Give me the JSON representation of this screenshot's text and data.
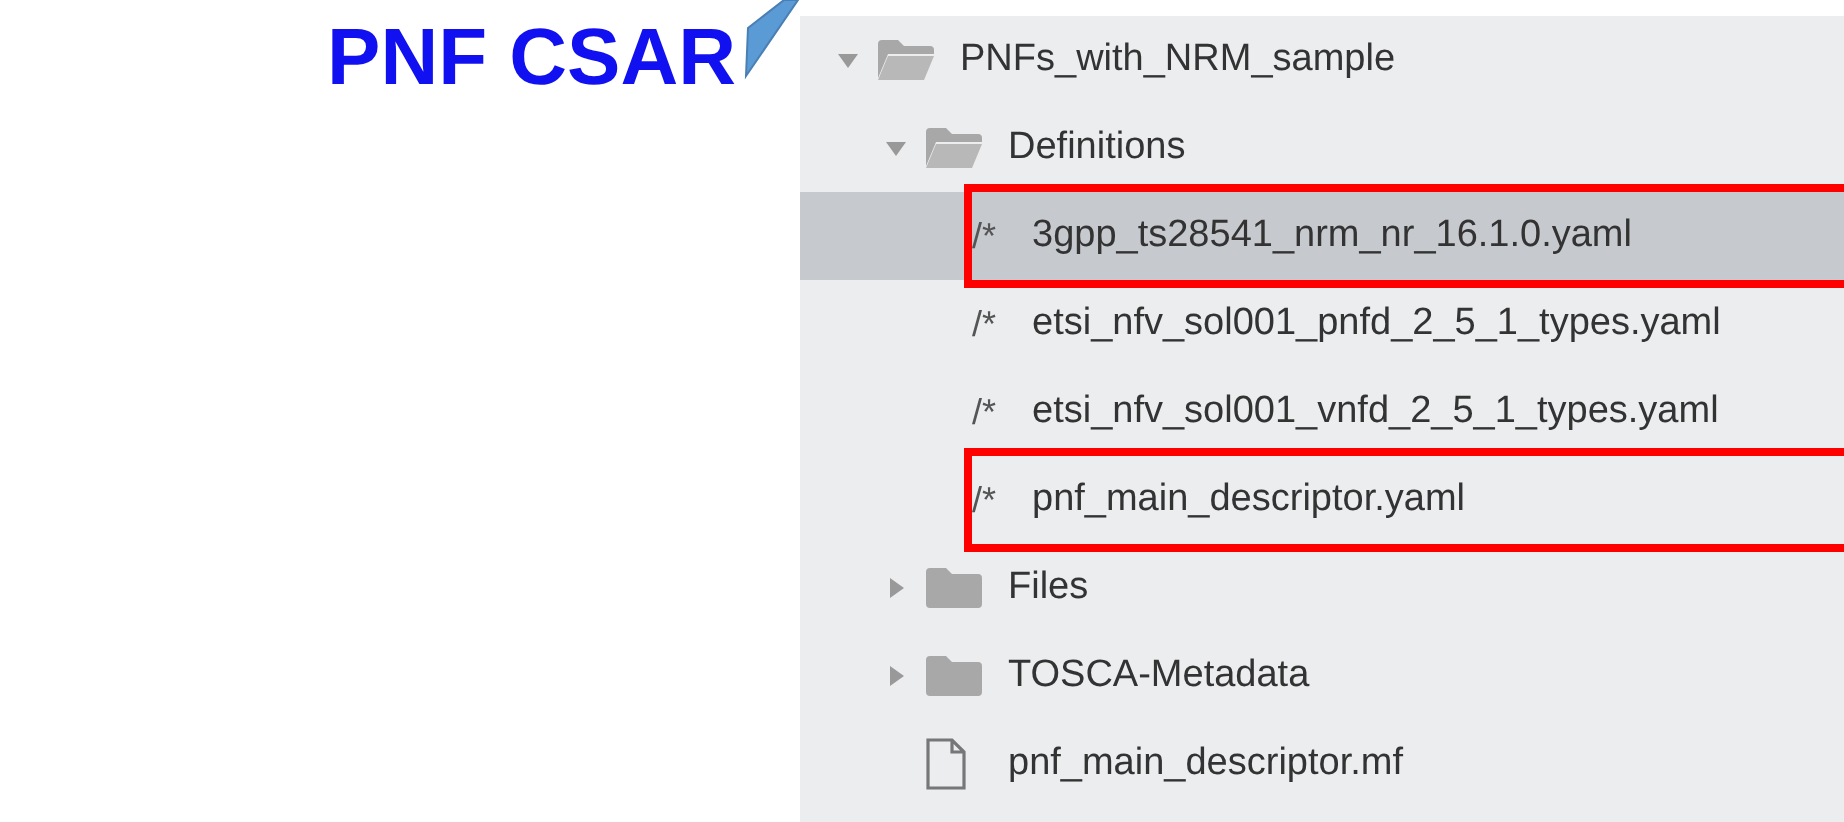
{
  "title": "PNF CSAR",
  "tree": [
    {
      "kind": "folder",
      "label": "PNFs_with_NRM_sample",
      "expanded": true,
      "children": [
        {
          "kind": "folder",
          "label": "Definitions",
          "expanded": true,
          "children": [
            {
              "kind": "code",
              "icon": "/*",
              "label": "3gpp_ts28541_nrm_nr_16.1.0.yaml",
              "selected": true,
              "highlighted": true
            },
            {
              "kind": "code",
              "icon": "/*",
              "label": "etsi_nfv_sol001_pnfd_2_5_1_types.yaml",
              "selected": false,
              "highlighted": false
            },
            {
              "kind": "code",
              "icon": "/*",
              "label": "etsi_nfv_sol001_vnfd_2_5_1_types.yaml",
              "selected": false,
              "highlighted": false
            },
            {
              "kind": "code",
              "icon": "/*",
              "label": "pnf_main_descriptor.yaml",
              "selected": false,
              "highlighted": true
            }
          ]
        },
        {
          "kind": "folder",
          "label": "Files",
          "expanded": false
        },
        {
          "kind": "folder",
          "label": "TOSCA-Metadata",
          "expanded": false
        },
        {
          "kind": "file",
          "label": "pnf_main_descriptor.mf",
          "selected": false,
          "highlighted": false
        }
      ]
    }
  ]
}
